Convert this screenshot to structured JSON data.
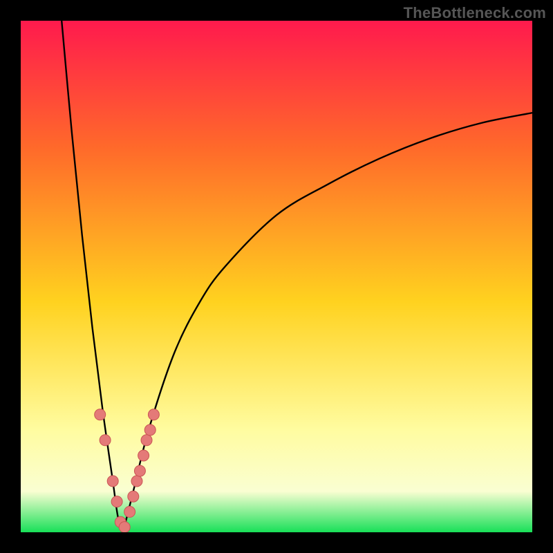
{
  "watermark": "TheBottleneck.com",
  "colors": {
    "frame": "#000000",
    "grad_top": "#ff1a4d",
    "grad_mid_upper": "#ff6a2a",
    "grad_mid": "#ffd21f",
    "grad_lower": "#fffca0",
    "grad_band_pale": "#fafed2",
    "grad_bottom": "#18e058",
    "curve": "#000000",
    "marker_fill": "#e47a78",
    "marker_stroke": "#c95554"
  },
  "chart_data": {
    "type": "line",
    "title": "",
    "xlabel": "",
    "ylabel": "",
    "xlim": [
      0,
      100
    ],
    "ylim": [
      0,
      100
    ],
    "notes": "V-shaped bottleneck curve; minimum (~0%) near x≈20. Left branch rises steeply to 100% at x≈8. Right branch rises asymptotically toward ~82% at x=100. Pink markers cluster along the curve near the bottom, y≲20.",
    "series": [
      {
        "name": "curve_left",
        "x": [
          8,
          10,
          12,
          14,
          16,
          18,
          19,
          20
        ],
        "y": [
          100,
          78,
          58,
          40,
          24,
          10,
          3,
          0
        ]
      },
      {
        "name": "curve_right",
        "x": [
          20,
          22,
          25,
          30,
          35,
          40,
          50,
          60,
          70,
          80,
          90,
          100
        ],
        "y": [
          0,
          8,
          20,
          35,
          45,
          52,
          62,
          68,
          73,
          77,
          80,
          82
        ]
      }
    ],
    "markers": {
      "name": "data-points",
      "x": [
        15.5,
        16.5,
        18.0,
        18.8,
        19.5,
        20.3,
        21.3,
        22.0,
        22.7,
        23.3,
        24.0,
        24.6,
        25.3,
        26.0
      ],
      "y": [
        23,
        18,
        10,
        6,
        2,
        1,
        4,
        7,
        10,
        12,
        15,
        18,
        20,
        23
      ]
    }
  }
}
